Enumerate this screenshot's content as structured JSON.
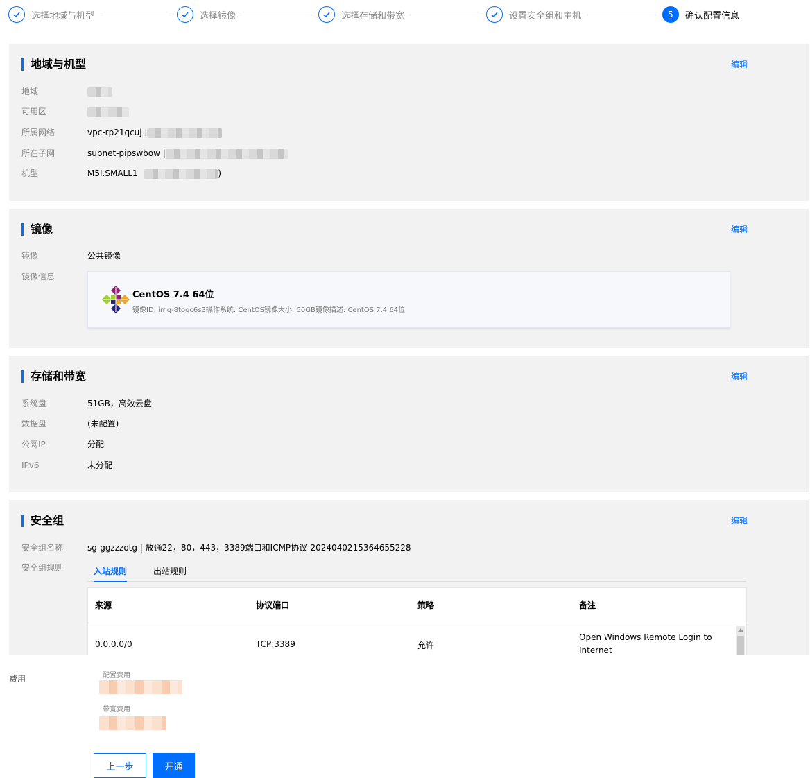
{
  "steps": [
    {
      "label": "选择地域与机型",
      "state": "done"
    },
    {
      "label": "选择镜像",
      "state": "done"
    },
    {
      "label": "选择存储和带宽",
      "state": "done"
    },
    {
      "label": "设置安全组和主机",
      "state": "done"
    },
    {
      "label": "确认配置信息",
      "state": "active",
      "number": "5"
    }
  ],
  "edit_label": "编辑",
  "region": {
    "title": "地域与机型",
    "rows": [
      {
        "label": "地域",
        "value": ""
      },
      {
        "label": "可用区",
        "value": ""
      },
      {
        "label": "所属网络",
        "value": "vpc-rp21qcuj |"
      },
      {
        "label": "所在子网",
        "value": "subnet-pipswbow |"
      },
      {
        "label": "机型",
        "value": "M5I.SMALL1",
        "suffix": ")"
      }
    ]
  },
  "image": {
    "title": "镜像",
    "rows": [
      {
        "label": "镜像",
        "value": "公共镜像"
      },
      {
        "label": "镜像信息",
        "value": ""
      }
    ],
    "card": {
      "name": "CentOS 7.4 64位",
      "desc": "镜像ID: img-8toqc6s3操作系统: CentOS镜像大小: 50GB镜像描述: CentOS 7.4 64位"
    }
  },
  "storage": {
    "title": "存储和带宽",
    "rows": [
      {
        "label": "系统盘",
        "value": "51GB，高效云盘"
      },
      {
        "label": "数据盘",
        "value": "(未配置)"
      },
      {
        "label": "公网IP",
        "value": "分配"
      },
      {
        "label": "IPv6",
        "value": "未分配"
      }
    ]
  },
  "security": {
    "title": "安全组",
    "name_label": "安全组名称",
    "name_value": "sg-ggzzzotg | 放通22，80，443，3389端口和ICMP协议-2024040215364655228",
    "rules_label": "安全组规则",
    "tabs": [
      "入站规则",
      "出站规则"
    ],
    "columns": [
      "来源",
      "协议端口",
      "策略",
      "备注"
    ],
    "rows": [
      {
        "source": "0.0.0.0/0",
        "port": "TCP:3389",
        "policy": "允许",
        "note_line1": "Open Windows Remote Login to",
        "note_line2": "Internet"
      }
    ]
  },
  "footer": {
    "fee_label": "费用",
    "config_fee_label": "配置费用",
    "bandwidth_fee_label": "带宽费用",
    "prev_button": "上一步",
    "submit_button": "开通"
  },
  "colors": {
    "accent": "#006eff",
    "section_bg": "#f2f2f2"
  }
}
